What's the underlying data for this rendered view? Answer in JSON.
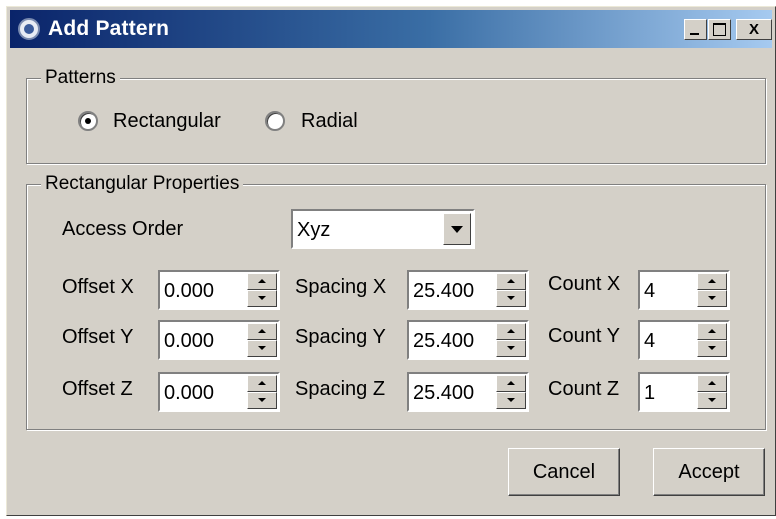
{
  "window": {
    "title": "Add Pattern",
    "icons": {
      "app": "app-icon",
      "minimize": "minimize-icon",
      "maximize": "maximize-icon",
      "close": "close-icon"
    },
    "close_label": "X"
  },
  "patterns": {
    "group_label": "Patterns",
    "options": [
      {
        "label": "Rectangular",
        "checked": true
      },
      {
        "label": "Radial",
        "checked": false
      }
    ]
  },
  "rect_props": {
    "group_label": "Rectangular Properties",
    "access_order": {
      "label": "Access Order",
      "value": "Xyz"
    },
    "offset": {
      "x_label": "Offset X",
      "y_label": "Offset Y",
      "z_label": "Offset Z",
      "x": "0.000",
      "y": "0.000",
      "z": "0.000"
    },
    "spacing": {
      "x_label": "Spacing X",
      "y_label": "Spacing Y",
      "z_label": "Spacing Z",
      "x": "25.400",
      "y": "25.400",
      "z": "25.400"
    },
    "count": {
      "x_label": "Count X",
      "y_label": "Count Y",
      "z_label": "Count Z",
      "x": "4",
      "y": "4",
      "z": "1"
    }
  },
  "buttons": {
    "cancel": "Cancel",
    "accept": "Accept"
  }
}
